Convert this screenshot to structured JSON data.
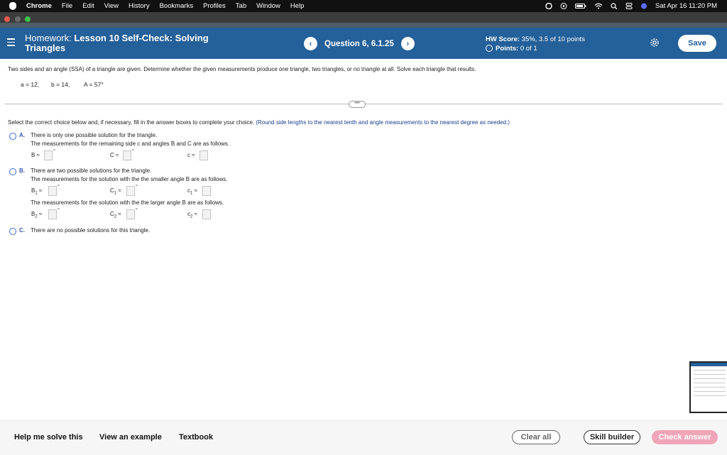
{
  "menubar": {
    "app": "Chrome",
    "items": [
      "File",
      "Edit",
      "View",
      "History",
      "Bookmarks",
      "Profiles",
      "Tab",
      "Window",
      "Help"
    ],
    "datetime": "Sat Apr 16  11:20 PM"
  },
  "header": {
    "title_prefix": "Homework: ",
    "title_bold": "Lesson 10 Self-Check: Solving",
    "title_line2": "Triangles",
    "question": "Question 6, 6.1.25",
    "prev": "‹",
    "next": "›",
    "hw_score_label": "HW Score:",
    "hw_score_value": " 35%, 3.5 of 10 points",
    "points_label": "Points:",
    "points_value": " 0 of 1",
    "save": "Save"
  },
  "problem": {
    "text": "Two sides and an angle (SSA) of a triangle are given. Determine whether the given measurements produce one triangle, two triangles, or no triangle at all. Solve each triangle that results.",
    "given_a": "a = 12,",
    "given_b": "b = 14,",
    "given_A": "A = 57°",
    "more": "•••"
  },
  "instructions": {
    "main": "Select the correct choice below and, if necessary, fill in the answer boxes to complete your choice. ",
    "note": "(Round side lengths to the nearest tenth and angle measurements to the nearest degree as needed.)"
  },
  "options": {
    "a": {
      "letter": "A.",
      "line1": "There is only one possible solution for the triangle.",
      "line2": "The measurements for the remaining side c and angles B and C are as follows.",
      "B": "B ≈",
      "C": "C ≈",
      "c": "c ≈"
    },
    "b": {
      "letter": "B.",
      "line1": "There are two possible solutions for the triangle.",
      "line2": "The measurements for the solution with the the smaller angle B are as follows.",
      "B1": "B",
      "C1": "C",
      "c1": "c",
      "sub1": "1",
      "line3": "The measurements for the solution with the the larger angle B are as follows.",
      "B2": "B",
      "C2": "C",
      "c2": "c",
      "sub2": "2",
      "approx": "≈"
    },
    "c": {
      "letter": "C.",
      "line1": "There are no possible solutions for this triangle."
    },
    "degree": "°"
  },
  "bottom": {
    "help": "Help me solve this",
    "example": "View an example",
    "textbook": "Textbook",
    "clear": "Clear all",
    "skill": "Skill builder",
    "check": "Check answer"
  },
  "colors": {
    "header_bg": "#246099",
    "link_blue": "#1b3d8f",
    "check_answer_bg": "#f0a5b9"
  }
}
